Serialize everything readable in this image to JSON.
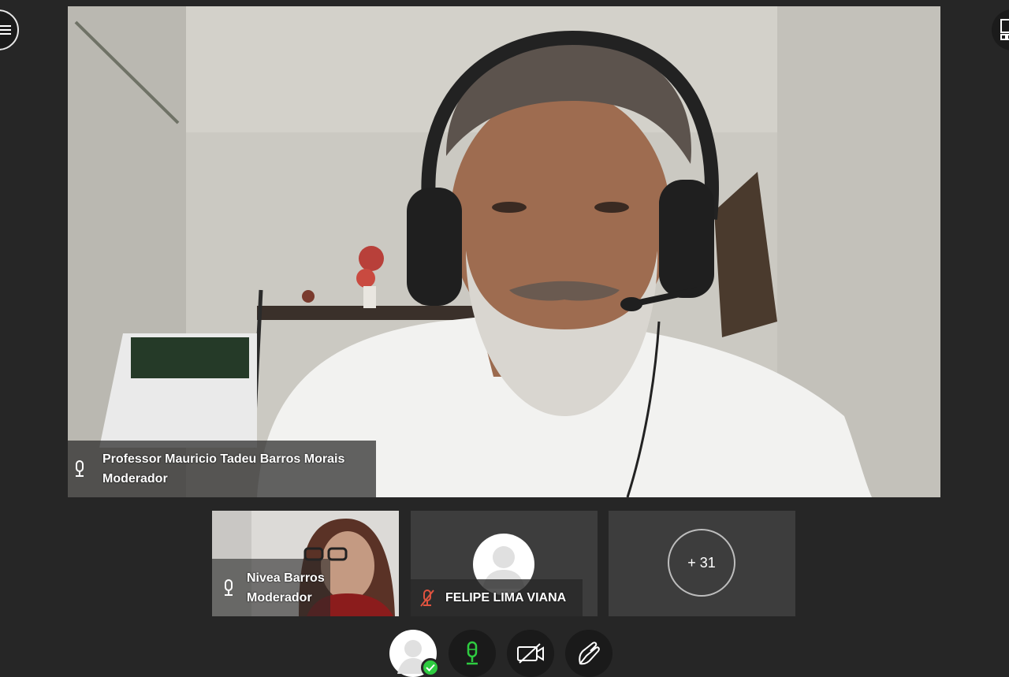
{
  "main_speaker": {
    "name": "Professor Mauricio Tadeu Barros Morais",
    "role": "Moderador",
    "mic_status": "active"
  },
  "thumbnails": [
    {
      "name": "Nivea Barros",
      "role": "Moderador",
      "mic_status": "active"
    },
    {
      "name": "FELIPE LIMA VIANA",
      "mic_status": "muted"
    }
  ],
  "more_participants": "+ 31",
  "controls": {
    "self_status": "online",
    "accent_green": "#2ecc40",
    "muted_color": "#e0533f"
  },
  "icons": [
    "menu-icon",
    "layout-icon",
    "microphone-icon",
    "camera-off-icon",
    "raise-hand-icon",
    "user-icon",
    "check-icon"
  ]
}
